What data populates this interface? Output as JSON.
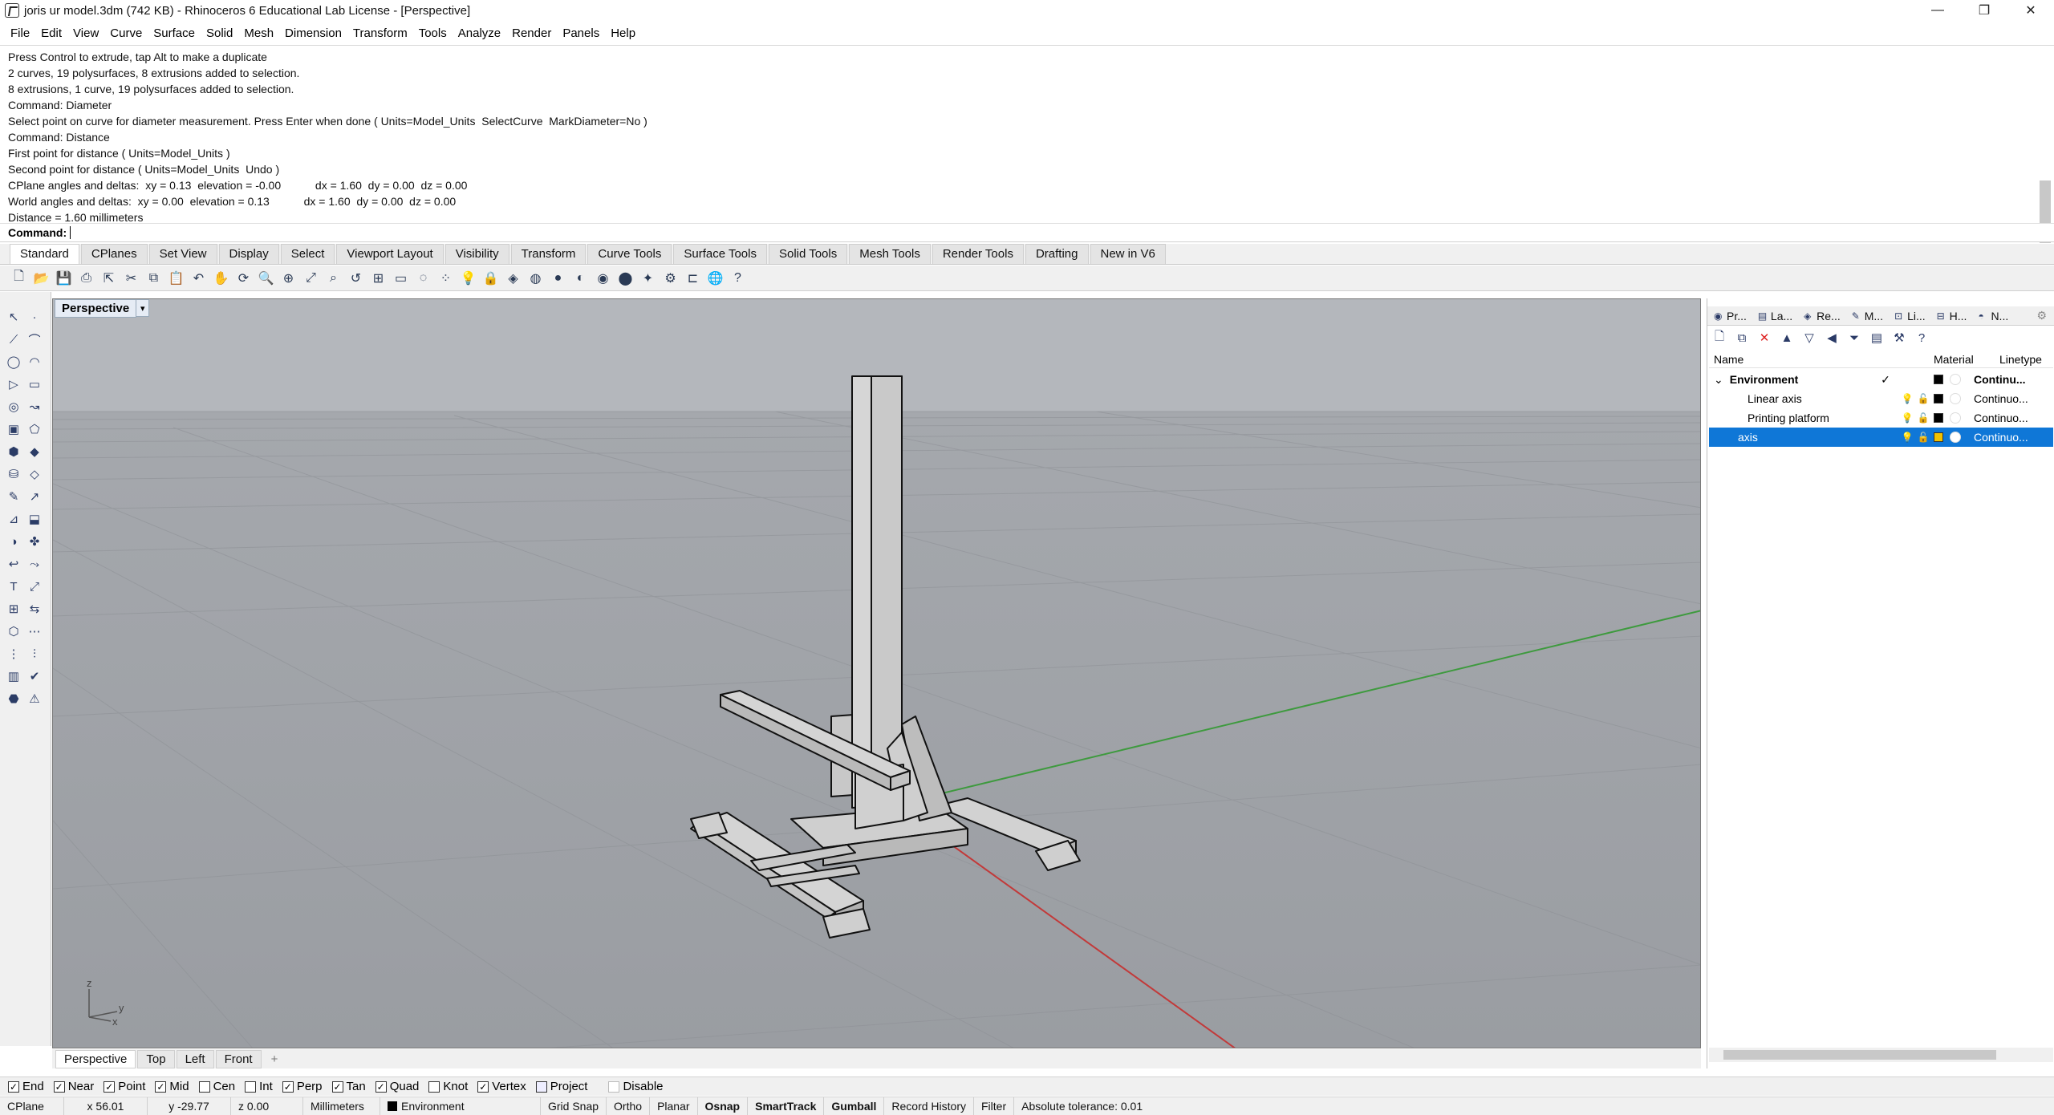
{
  "window": {
    "title": "joris ur model.3dm (742 KB) - Rhinoceros 6 Educational Lab License - [Perspective]",
    "minimize": "—",
    "maximize": "❐",
    "close": "✕"
  },
  "menu": [
    "File",
    "Edit",
    "View",
    "Curve",
    "Surface",
    "Solid",
    "Mesh",
    "Dimension",
    "Transform",
    "Tools",
    "Analyze",
    "Render",
    "Panels",
    "Help"
  ],
  "command_history": [
    "Press Control to extrude, tap Alt to make a duplicate",
    "2 curves, 19 polysurfaces, 8 extrusions added to selection.",
    "8 extrusions, 1 curve, 19 polysurfaces added to selection.",
    "Command: Diameter",
    "Select point on curve for diameter measurement. Press Enter when done ( Units=Model_Units  SelectCurve  MarkDiameter=No )",
    "Command: Distance",
    "First point for distance ( Units=Model_Units )",
    "Second point for distance ( Units=Model_Units  Undo )",
    "CPlane angles and deltas:  xy = 0.13  elevation = -0.00           dx = 1.60  dy = 0.00  dz = 0.00",
    "World angles and deltas:  xy = 0.00  elevation = 0.13           dx = 1.60  dy = 0.00  dz = 0.00",
    "Distance = 1.60 millimeters"
  ],
  "command_prompt": "Command:",
  "toolbar_tabs": [
    "Standard",
    "CPlanes",
    "Set View",
    "Display",
    "Select",
    "Viewport Layout",
    "Visibility",
    "Transform",
    "Curve Tools",
    "Surface Tools",
    "Solid Tools",
    "Mesh Tools",
    "Render Tools",
    "Drafting",
    "New in V6"
  ],
  "active_toolbar_tab": "Standard",
  "viewport": {
    "name": "Perspective",
    "dropdown": "▾",
    "axis_labels": {
      "z": "z",
      "y": "y",
      "x": "x"
    },
    "colors": {
      "background_top": "#a8abb0",
      "background_bottom": "#9c9fa4",
      "x_axis": "#c03030",
      "y_axis": "#3a9a3a",
      "model_fill": "#d8d8d8",
      "model_edge": "#111111"
    }
  },
  "viewport_tabs": [
    "Perspective",
    "Top",
    "Left",
    "Front"
  ],
  "viewport_tab_add": "+",
  "osnap": [
    {
      "label": "End",
      "checked": true
    },
    {
      "label": "Near",
      "checked": true
    },
    {
      "label": "Point",
      "checked": true
    },
    {
      "label": "Mid",
      "checked": true
    },
    {
      "label": "Cen",
      "checked": false
    },
    {
      "label": "Int",
      "checked": false
    },
    {
      "label": "Perp",
      "checked": true
    },
    {
      "label": "Tan",
      "checked": true
    },
    {
      "label": "Quad",
      "checked": true
    },
    {
      "label": "Knot",
      "checked": false
    },
    {
      "label": "Vertex",
      "checked": true
    },
    {
      "label": "Project",
      "checked": false
    },
    {
      "label": "Disable",
      "checked": false
    }
  ],
  "status": {
    "cplane": "CPlane",
    "x": "x 56.01",
    "y": "y -29.77",
    "z": "z 0.00",
    "units": "Millimeters",
    "layer": "Environment",
    "grid_snap": "Grid Snap",
    "ortho": "Ortho",
    "planar": "Planar",
    "osnap": "Osnap",
    "smarttrack": "SmartTrack",
    "gumball": "Gumball",
    "record_history": "Record History",
    "filter": "Filter",
    "tolerance": "Absolute tolerance: 0.01"
  },
  "panel": {
    "tabs": [
      {
        "label": "Pr...",
        "icon": "properties-icon"
      },
      {
        "label": "La...",
        "icon": "layers-icon"
      },
      {
        "label": "Re...",
        "icon": "render-icon"
      },
      {
        "label": "M...",
        "icon": "materials-icon"
      },
      {
        "label": "Li...",
        "icon": "libraries-icon"
      },
      {
        "label": "H...",
        "icon": "help-icon"
      },
      {
        "label": "N...",
        "icon": "notes-icon"
      }
    ],
    "columns": {
      "name": "Name",
      "material": "Material",
      "linetype": "Linetype"
    },
    "layers": [
      {
        "name": "Environment",
        "current": "✓",
        "linetype": "Continu...",
        "color": "#000000",
        "selected": false,
        "indent": 0,
        "expand": "⌄"
      },
      {
        "name": "Linear axis",
        "current": "",
        "linetype": "Continuo...",
        "color": "#000000",
        "selected": false,
        "indent": 1,
        "expand": ""
      },
      {
        "name": "Printing platform",
        "current": "",
        "linetype": "Continuo...",
        "color": "#000000",
        "selected": false,
        "indent": 1,
        "expand": ""
      },
      {
        "name": "axis",
        "current": "",
        "linetype": "Continuo...",
        "color": "#f2c200",
        "selected": true,
        "indent": 0,
        "expand": ""
      }
    ]
  }
}
